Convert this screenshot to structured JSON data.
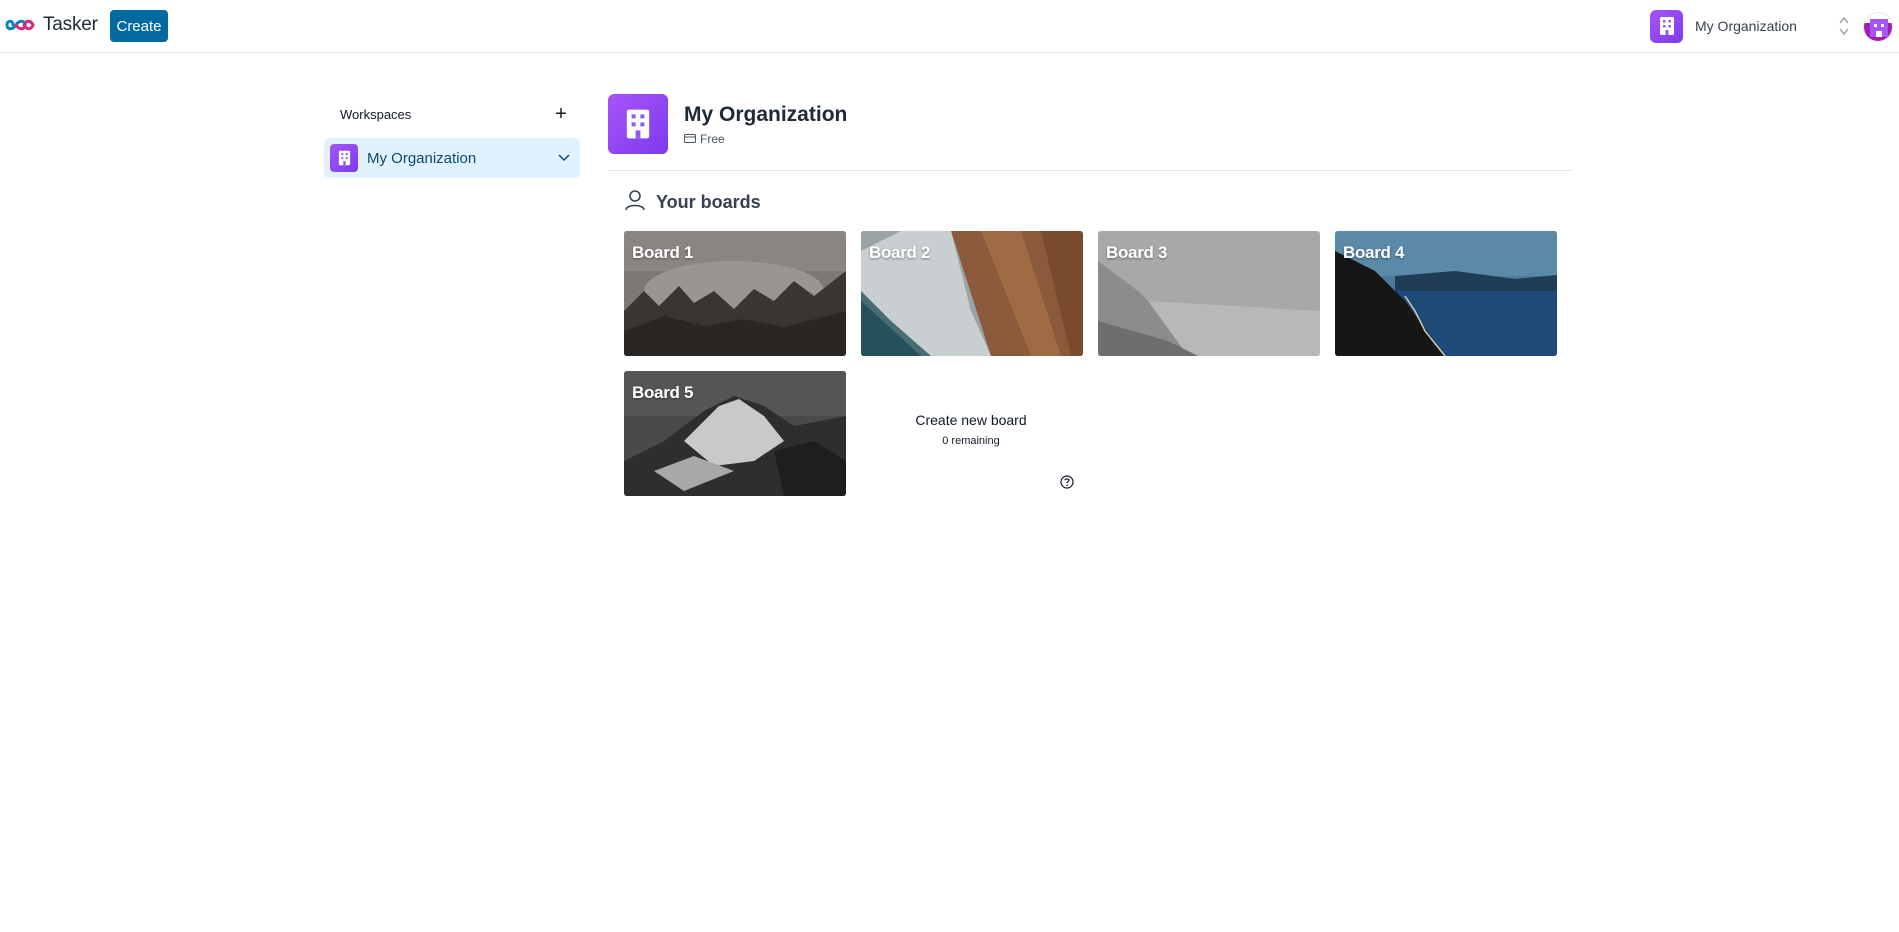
{
  "navbar": {
    "app_name": "Tasker",
    "create_label": "Create",
    "org_switcher_label": "My Organization"
  },
  "sidebar": {
    "title": "Workspaces",
    "add_label": "+",
    "items": [
      {
        "label": "My Organization",
        "selected": true
      }
    ]
  },
  "org": {
    "name": "My Organization",
    "plan": "Free"
  },
  "boards_section": {
    "title": "Your boards",
    "boards": [
      {
        "title": "Board 1",
        "theme": "misty-forest"
      },
      {
        "title": "Board 2",
        "theme": "aerial-beach"
      },
      {
        "title": "Board 3",
        "theme": "grey-shore"
      },
      {
        "title": "Board 4",
        "theme": "blue-lake-road"
      },
      {
        "title": "Board 5",
        "theme": "snowy-mountain"
      }
    ],
    "create_label": "Create new board",
    "remaining": "0 remaining"
  },
  "colors": {
    "brand_blue": "#0369a1",
    "org_purple": "#8b5cf6",
    "selected_bg": "#e0f2fe"
  }
}
